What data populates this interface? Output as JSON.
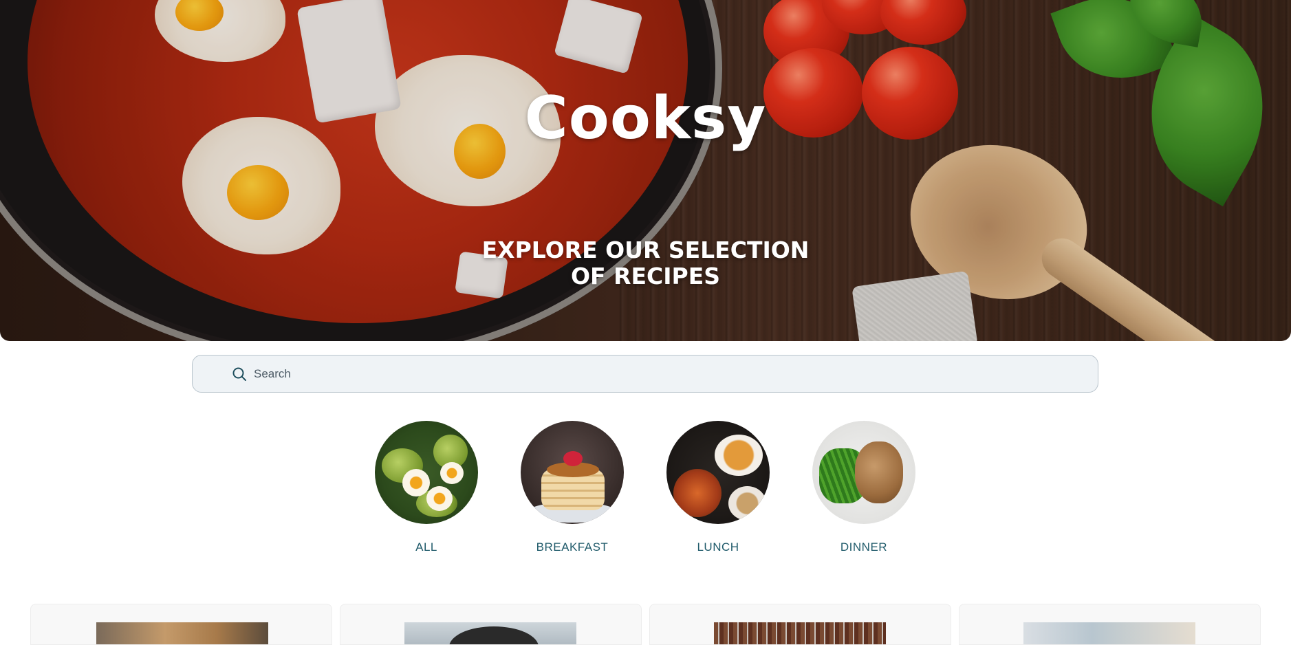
{
  "hero": {
    "brand": "Cooksy",
    "tagline": "EXPLORE OUR SELECTION OF RECIPES"
  },
  "search": {
    "placeholder": "Search",
    "icon": "search-icon"
  },
  "categories": [
    {
      "label": "ALL",
      "image": "salad-image"
    },
    {
      "label": "BREAKFAST",
      "image": "pancakes-image"
    },
    {
      "label": "LUNCH",
      "image": "lunch-bowls-image"
    },
    {
      "label": "DINNER",
      "image": "dinner-plate-image"
    }
  ],
  "colors": {
    "category_label": "#1f5a6a",
    "search_background": "#eff3f6",
    "search_border": "#b9c4cc"
  }
}
